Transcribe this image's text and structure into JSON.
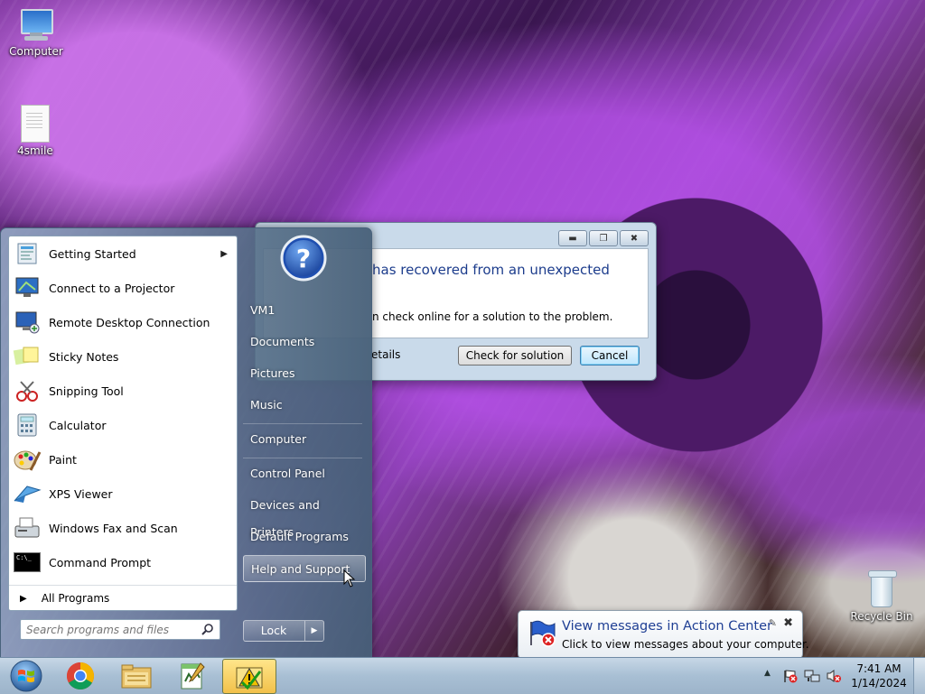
{
  "desktop": {
    "icons": [
      {
        "label": "Computer"
      },
      {
        "label": "4smile"
      },
      {
        "label": "Recycle Bin"
      }
    ]
  },
  "dialog": {
    "headline": "has recovered from an unexpected",
    "message": "n check online for a solution to the problem.",
    "details_link": "etails",
    "check_button": "Check for solution",
    "cancel_button": "Cancel",
    "caption_buttons": [
      "minimize-icon",
      "restore-icon",
      "close-icon"
    ]
  },
  "start_menu": {
    "programs": [
      {
        "label": "Getting Started",
        "icon": "getting-started-icon",
        "has_submenu": true
      },
      {
        "label": "Connect to a Projector",
        "icon": "projector-icon"
      },
      {
        "label": "Remote Desktop Connection",
        "icon": "remote-desktop-icon"
      },
      {
        "label": "Sticky Notes",
        "icon": "sticky-notes-icon"
      },
      {
        "label": "Snipping Tool",
        "icon": "snipping-tool-icon"
      },
      {
        "label": "Calculator",
        "icon": "calculator-icon"
      },
      {
        "label": "Paint",
        "icon": "paint-icon"
      },
      {
        "label": "XPS Viewer",
        "icon": "xps-viewer-icon"
      },
      {
        "label": "Windows Fax and Scan",
        "icon": "fax-scan-icon"
      },
      {
        "label": "Command Prompt",
        "icon": "command-prompt-icon"
      }
    ],
    "all_programs": "All Programs",
    "search_placeholder": "Search programs and files",
    "right_links": [
      {
        "label": "VM1"
      },
      {
        "label": "Documents"
      },
      {
        "label": "Pictures"
      },
      {
        "label": "Music"
      },
      {
        "label": "Computer"
      },
      {
        "label": "Control Panel"
      },
      {
        "label": "Devices and Printers"
      },
      {
        "label": "Default Programs"
      },
      {
        "label": "Help and Support",
        "hovered": true
      }
    ],
    "lock_button": "Lock",
    "cmd_icon_text": "C:\\_"
  },
  "notification": {
    "title": "View messages in Action Center",
    "subtitle": "Click to view messages about your computer."
  },
  "taskbar": {
    "buttons": [
      "start-orb-icon",
      "chrome-icon",
      "file-explorer-icon",
      "notepad-app-icon",
      "action-center-app-icon"
    ],
    "clock_time": "7:41 AM",
    "clock_date": "1/14/2024"
  },
  "colors": {
    "link_blue": "#1c3c8c",
    "taskbar": "#a8bfd4",
    "active_task": "#f2c14a"
  }
}
